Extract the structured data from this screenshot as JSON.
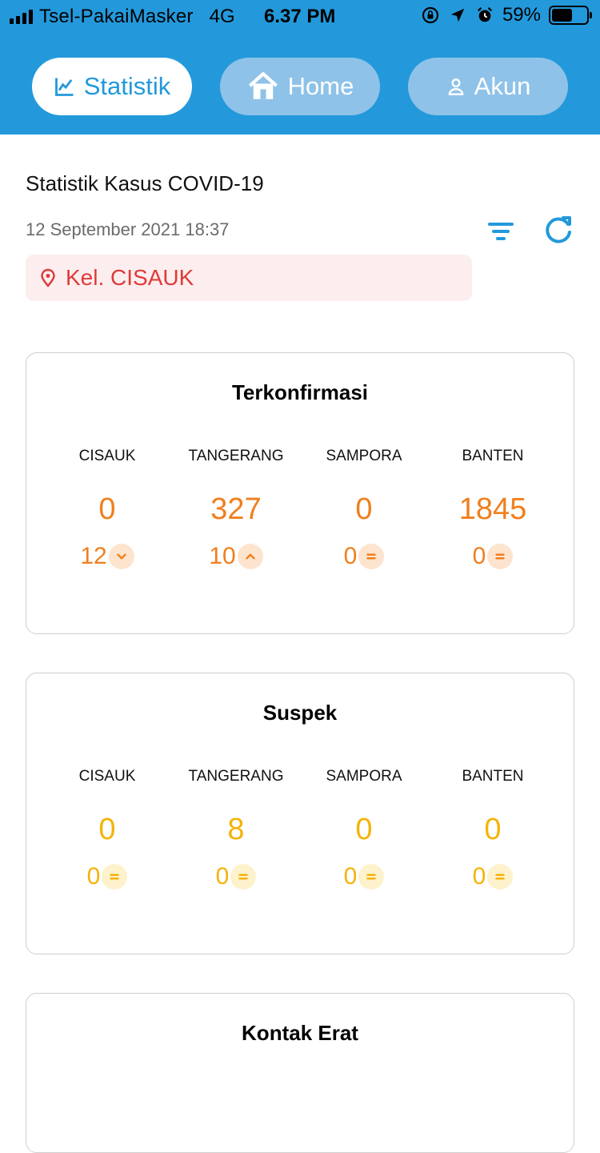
{
  "status_bar": {
    "carrier": "Tsel-PakaiMasker",
    "network": "4G",
    "time": "6.37 PM",
    "battery": "59%",
    "battery_level": 0.59
  },
  "nav": {
    "tabs": [
      {
        "label": "Statistik",
        "icon": "chart-icon",
        "active": true
      },
      {
        "label": "Home",
        "icon": "home-icon",
        "active": false
      },
      {
        "label": "Akun",
        "icon": "user-icon",
        "active": false
      }
    ]
  },
  "page": {
    "title": "Statistik Kasus COVID-19",
    "date": "12 September 2021 18:37",
    "location": "Kel. CISAUK"
  },
  "colors": {
    "header": "#2399DB",
    "orange": "#F07F1E",
    "yellow": "#F5B30A",
    "location_text": "#E03A3A"
  },
  "sections": [
    {
      "title": "Terkonfirmasi",
      "color": "orange",
      "columns": [
        {
          "label": "CISAUK",
          "value": "0",
          "delta": "12",
          "trend": "down"
        },
        {
          "label": "TANGERANG",
          "value": "327",
          "delta": "10",
          "trend": "up"
        },
        {
          "label": "SAMPORA",
          "value": "0",
          "delta": "0",
          "trend": "equal"
        },
        {
          "label": "BANTEN",
          "value": "1845",
          "delta": "0",
          "trend": "equal"
        }
      ]
    },
    {
      "title": "Suspek",
      "color": "yellow",
      "columns": [
        {
          "label": "CISAUK",
          "value": "0",
          "delta": "0",
          "trend": "equal"
        },
        {
          "label": "TANGERANG",
          "value": "8",
          "delta": "0",
          "trend": "equal"
        },
        {
          "label": "SAMPORA",
          "value": "0",
          "delta": "0",
          "trend": "equal"
        },
        {
          "label": "BANTEN",
          "value": "0",
          "delta": "0",
          "trend": "equal"
        }
      ]
    },
    {
      "title": "Kontak Erat"
    }
  ]
}
